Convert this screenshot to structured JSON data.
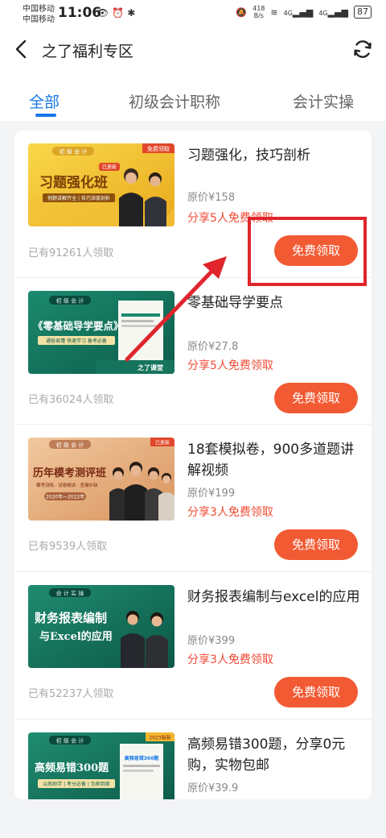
{
  "status_bar": {
    "carrier_1": "中国移动",
    "carrier_2": "中国移动",
    "time": "11:06",
    "net_speed_value": "418",
    "net_speed_unit": "B/s",
    "signal_1": "4G",
    "signal_2": "4G",
    "battery": "87"
  },
  "header": {
    "title": "之了福利专区",
    "back_icon": "chevron-left-icon",
    "refresh_icon": "refresh-icon"
  },
  "tabs": [
    {
      "label": "全部",
      "active": true
    },
    {
      "label": "初级会计职称",
      "active": false
    },
    {
      "label": "会计实操",
      "active": false
    }
  ],
  "items": [
    {
      "title": "习题强化，技巧剖析",
      "price": "原价¥158",
      "share": "分享5人免费领取",
      "count": "已有91261人领取",
      "button": "免费领取",
      "thumb": {
        "tag": "初 级 会 计",
        "corner": "免费领取",
        "badge": "已更新",
        "headline": "习题强化班",
        "sub": "例题讲解齐全 | 技巧深度剖析"
      }
    },
    {
      "title": "零基础导学要点",
      "price": "原价¥27.8",
      "share": "分享5人免费领取",
      "count": "已有36024人领取",
      "button": "免费领取",
      "thumb": {
        "tag": "初 级 会 计",
        "headline": "《零基础导学要点》",
        "sub": "通俗易懂  快速学习  备考必备",
        "brand": "之了课堂"
      }
    },
    {
      "title": "18套模拟卷，900多道题讲解视频",
      "price": "原价¥199",
      "share": "分享3人免费领取",
      "count": "已有9539人领取",
      "button": "免费领取",
      "thumb": {
        "tag": "初 级 会 计",
        "badge": "已更新",
        "headline": "历年模考测评班",
        "sub": "模考测练 · 试卷精讲 · 查漏补缺",
        "years": "2020年—2022年"
      }
    },
    {
      "title": "财务报表编制与excel的应用",
      "price": "原价¥399",
      "share": "分享3人免费领取",
      "count": "已有52237人领取",
      "button": "免费领取",
      "thumb": {
        "tag": "会 计 实 操",
        "headline": "财务报表编制",
        "headline2": "与Excel的应用"
      }
    },
    {
      "title": "高频易错300题，分享0元购，实物包邮",
      "price": "原价¥39.9",
      "thumb": {
        "tag": "初 级 会 计",
        "badge": "2023版新",
        "headline": "高频易错300题",
        "sub": "以练助学 | 考分必备 | 包邮到家",
        "book": "高频易错300题"
      }
    }
  ],
  "colors": {
    "accent_blue": "#1677e8",
    "claim_orange": "#f25a33",
    "share_red": "#f24a33",
    "annotation_red": "#e0252c"
  }
}
